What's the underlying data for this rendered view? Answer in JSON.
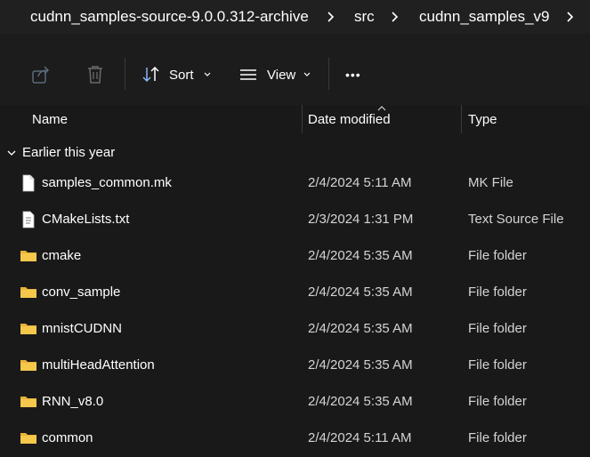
{
  "breadcrumb": {
    "items": [
      "cudnn_samples-source-9.0.0.312-archive",
      "src",
      "cudnn_samples_v9"
    ]
  },
  "toolbar": {
    "sort_label": "Sort",
    "view_label": "View",
    "more_label": "•••"
  },
  "columns": {
    "name": "Name",
    "date": "Date modified",
    "type": "Type"
  },
  "group": {
    "label": "Earlier this year"
  },
  "files": [
    {
      "name": "samples_common.mk",
      "date": "2/4/2024 5:11 AM",
      "type": "MK File",
      "icon": "file-icon"
    },
    {
      "name": "CMakeLists.txt",
      "date": "2/3/2024 1:31 PM",
      "type": "Text Source File",
      "icon": "text-file-icon"
    },
    {
      "name": "cmake",
      "date": "2/4/2024 5:35 AM",
      "type": "File folder",
      "icon": "folder-icon"
    },
    {
      "name": "conv_sample",
      "date": "2/4/2024 5:35 AM",
      "type": "File folder",
      "icon": "folder-icon"
    },
    {
      "name": "mnistCUDNN",
      "date": "2/4/2024 5:35 AM",
      "type": "File folder",
      "icon": "folder-icon"
    },
    {
      "name": "multiHeadAttention",
      "date": "2/4/2024 5:35 AM",
      "type": "File folder",
      "icon": "folder-icon"
    },
    {
      "name": "RNN_v8.0",
      "date": "2/4/2024 5:35 AM",
      "type": "File folder",
      "icon": "folder-icon"
    },
    {
      "name": "common",
      "date": "2/4/2024 5:11 AM",
      "type": "File folder",
      "icon": "folder-icon"
    }
  ],
  "colors": {
    "background": "#191919",
    "folder": "#f5c84c",
    "text": "#ffffff"
  }
}
